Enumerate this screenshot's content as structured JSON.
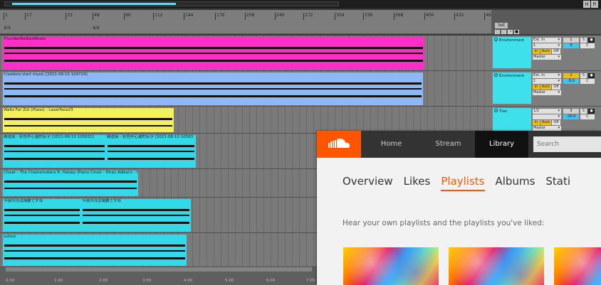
{
  "ruler": {
    "bars": [
      "1",
      "17",
      "33",
      "48",
      "80",
      "112",
      "144",
      "176",
      "208",
      "240",
      "272",
      "304",
      "336",
      "368",
      "400",
      "432",
      "464"
    ],
    "signatures": [
      "4/4",
      "4/4"
    ]
  },
  "header_buttons": [
    "H",
    "R"
  ],
  "set": {
    "label": "Set"
  },
  "tracks": [
    {
      "clips": [
        {
          "title": "ThunderNoStartMusic",
          "color": "#ff2ec7"
        }
      ],
      "mixer": {
        "name": "Environment",
        "input": "Ext. In",
        "channel": "1",
        "route": "Master",
        "monitor": [
          "In",
          "Auto",
          "Off"
        ],
        "number": "1",
        "pan": "0",
        "c": "C",
        "s": "S",
        "color": "#3ee0ec"
      }
    },
    {
      "clips": [
        {
          "title": "Creeleno start music [2021-08-10 104724]",
          "color": "#8db7f5"
        }
      ],
      "mixer": {
        "name": "Environment",
        "input": "Ext. In",
        "channel": "1",
        "route": "Master",
        "monitor": [
          "In",
          "Auto",
          "Off"
        ],
        "number": "2",
        "pan": "-5.0",
        "c": "C",
        "s": "S",
        "color": "#3ee0ec"
      }
    },
    {
      "clips": [
        {
          "title": "Waltz For Zizi (Piano) - LaserFace23",
          "color": "#f4ef5c"
        }
      ],
      "mixer": {
        "name": "Tian",
        "input": "1/2",
        "channel": "",
        "route": "Master",
        "monitor": [
          "In",
          "Auto",
          "Off"
        ],
        "number": "3",
        "pan": "-20.0",
        "c": "C",
        "s": "S",
        "color": "#3ee0ec"
      }
    },
    {
      "clips": [
        {
          "title": "間違探 - 彩色中心選的名字 [2021-08-10 105931]",
          "color": "#33d9e8"
        },
        {
          "title": "間違探 - 彩色中心選的名字 [2021-08-10 10593",
          "color": "#33d9e8"
        }
      ]
    },
    {
      "clips": [
        {
          "title": "Closer - The Chainsmokers ft. Halsey (Piano Cover - Hiran Adikari) - H",
          "color": "#33d9e8"
        }
      ]
    },
    {
      "clips": [
        {
          "title": "今夜の月は綺麗ですね",
          "color": "#33d9e8"
        },
        {
          "title": "今夜の月は綺麗ですね",
          "color": "#33d9e8"
        }
      ]
    },
    {
      "clips": [
        {
          "title": "yuhuo",
          "color": "#33d9e8"
        }
      ]
    }
  ],
  "timeline": [
    "0:00",
    "1:00",
    "2:00",
    "3:00",
    "4:00",
    "5:00",
    "6:00",
    "7:00"
  ],
  "soundcloud": {
    "nav": [
      "Home",
      "Stream",
      "Library"
    ],
    "active_nav": "Library",
    "search_placeholder": "Search",
    "tabs": [
      "Overview",
      "Likes",
      "Playlists",
      "Albums",
      "Stati"
    ],
    "active_tab": "Playlists",
    "subtitle": "Hear your own playlists and the playlists you've liked:",
    "accent": "#ff5500"
  }
}
